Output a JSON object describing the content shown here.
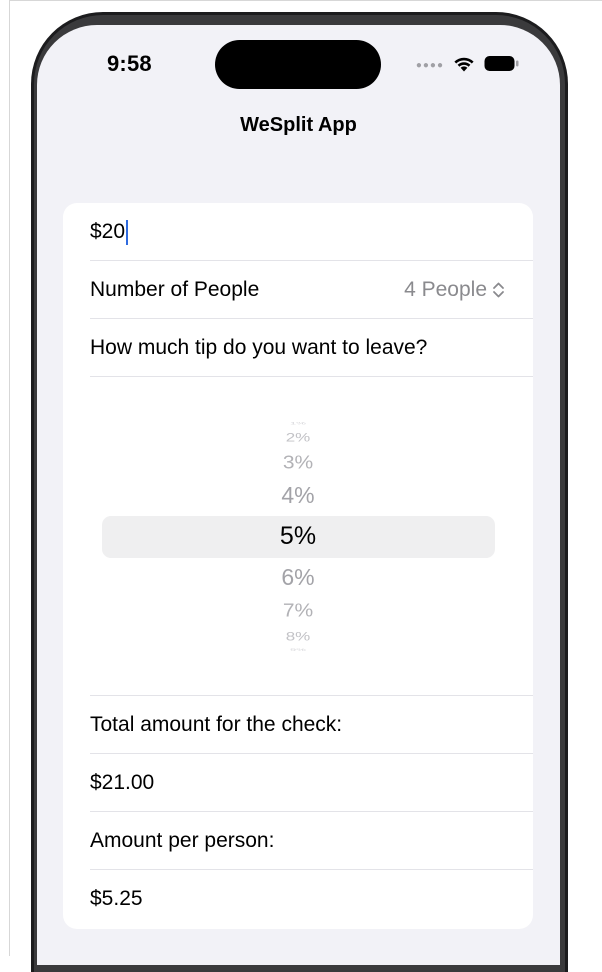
{
  "status_bar": {
    "time": "9:58",
    "icons": [
      "signal-dots-icon",
      "wifi-icon",
      "battery-icon"
    ]
  },
  "nav": {
    "title": "WeSplit App"
  },
  "form": {
    "amount_value": "$20",
    "people": {
      "label": "Number of People",
      "value": "4 People"
    },
    "tip_prompt": "How much tip do you want to leave?",
    "tip_picker": {
      "options": [
        "1%",
        "2%",
        "3%",
        "4%",
        "5%",
        "6%",
        "7%",
        "8%",
        "9%"
      ],
      "selected": "5%"
    },
    "total_label": "Total amount for the check:",
    "total_value": "$21.00",
    "per_person_label": "Amount per person:",
    "per_person_value": "$5.25"
  },
  "colors": {
    "background": "#f2f2f7",
    "card": "#ffffff",
    "secondary_text": "#8a8a8e",
    "cursor": "#2f6bdf"
  }
}
